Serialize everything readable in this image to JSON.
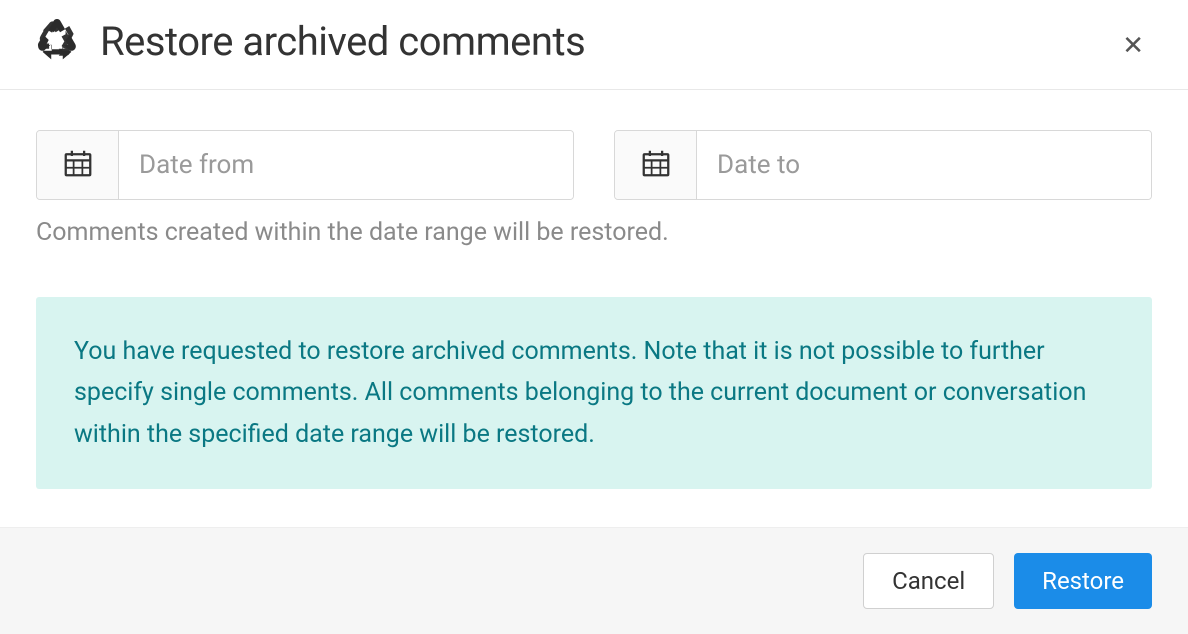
{
  "header": {
    "title": "Restore archived comments"
  },
  "form": {
    "dateFrom": {
      "placeholder": "Date from",
      "value": ""
    },
    "dateTo": {
      "placeholder": "Date to",
      "value": ""
    },
    "helperText": "Comments created within the date range will be restored."
  },
  "infoBox": {
    "message": "You have requested to restore archived comments. Note that it is not possible to further specify single comments. All comments belonging to the current document or conversation within the specified date range will be restored."
  },
  "footer": {
    "cancelLabel": "Cancel",
    "restoreLabel": "Restore"
  }
}
